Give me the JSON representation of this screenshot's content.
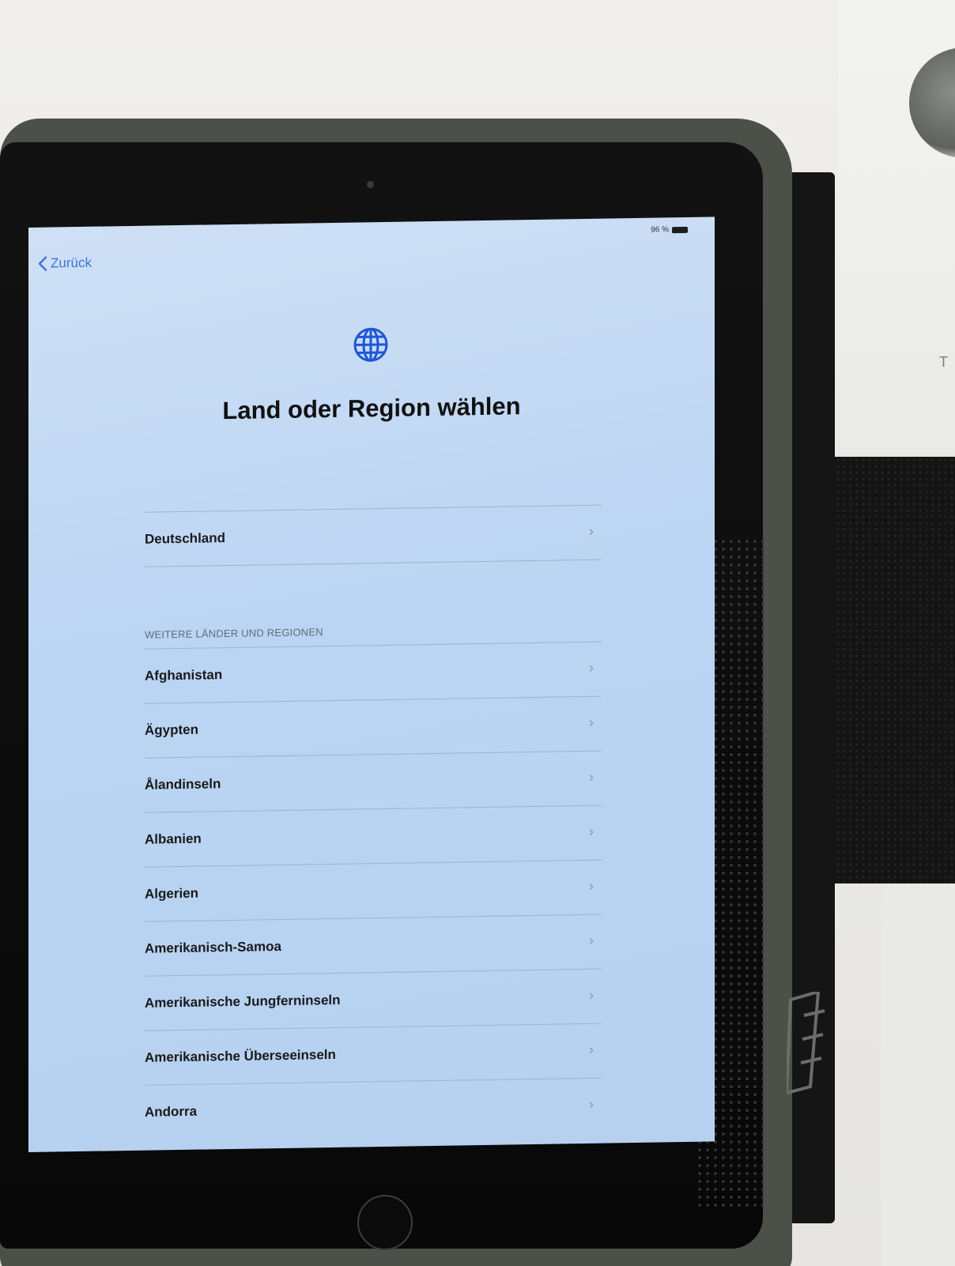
{
  "status_bar": {
    "battery_percent": "96 %"
  },
  "navigation": {
    "back_label": "Zurück"
  },
  "header": {
    "icon": "globe-icon",
    "title": "Land oder Region wählen"
  },
  "primary_list": [
    {
      "label": "Deutschland"
    }
  ],
  "section": {
    "header": "WEITERE LÄNDER UND REGIONEN"
  },
  "other_countries": [
    {
      "label": "Afghanistan"
    },
    {
      "label": "Ägypten"
    },
    {
      "label": "Ålandinseln"
    },
    {
      "label": "Albanien"
    },
    {
      "label": "Algerien"
    },
    {
      "label": "Amerikanisch-Samoa"
    },
    {
      "label": "Amerikanische Jungferninseln"
    },
    {
      "label": "Amerikanische Überseeinseln"
    },
    {
      "label": "Andorra"
    }
  ],
  "colors": {
    "accent": "#3b74d4",
    "screen_background": "#bad4f3"
  }
}
